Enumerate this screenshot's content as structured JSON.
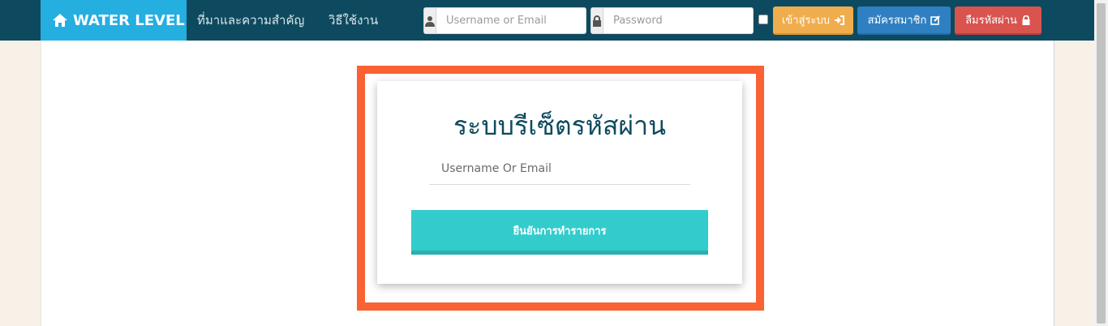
{
  "navbar": {
    "brand": "WATER LEVEL",
    "links": [
      "ที่มาและความสำคัญ",
      "วิธีใช้งาน"
    ],
    "username_placeholder": "Username or Email",
    "password_placeholder": "Password",
    "login_label": "เข้าสู่ระบบ",
    "register_label": "สมัครสมาชิก",
    "forgot_label": "ลืมรหัสผ่าน"
  },
  "card": {
    "title": "ระบบรีเซ็ตรหัสผ่าน",
    "input_placeholder": "Username Or Email",
    "submit_label": "ยืนยันการทำรายการ"
  },
  "colors": {
    "navbar": "#0e4a5f",
    "brand": "#25aee0",
    "login": "#f0ad4e",
    "register": "#2f80c3",
    "forgot": "#d9534f",
    "submit": "#33cccc",
    "highlight": "#fa6133"
  },
  "icons": {
    "brand": "home-icon",
    "username": "user-icon",
    "password": "lock-icon",
    "login": "sign-in-icon",
    "register": "edit-icon",
    "forgot": "lock-icon"
  }
}
